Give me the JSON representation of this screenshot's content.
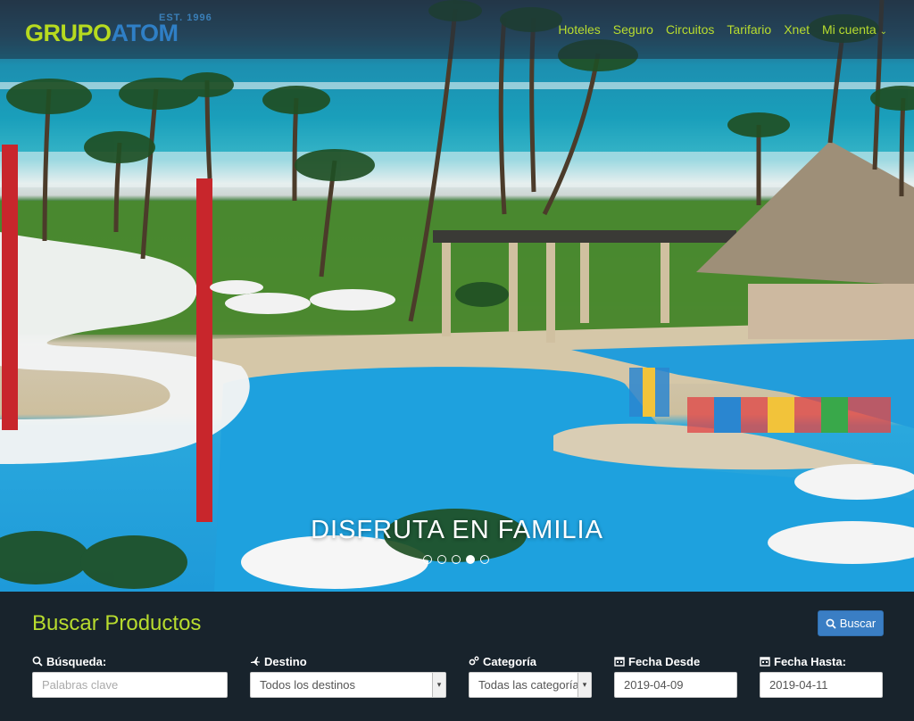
{
  "brand": {
    "name_part1": "GRUPO",
    "name_part2": "ATOM",
    "established": "EST. 1996"
  },
  "nav": {
    "items": [
      {
        "label": "Hoteles"
      },
      {
        "label": "Seguro"
      },
      {
        "label": "Circuitos"
      },
      {
        "label": "Tarifario"
      },
      {
        "label": "Xnet"
      },
      {
        "label": "Mi cuenta"
      }
    ]
  },
  "hero": {
    "caption": "DISFRUTA EN FAMILIA",
    "slides_total": 5,
    "active_slide": 4
  },
  "search": {
    "title": "Buscar Productos",
    "button_label": "Buscar",
    "fields": {
      "query": {
        "label": "Búsqueda:",
        "placeholder": "Palabras clave",
        "icon": "search-icon"
      },
      "destination": {
        "label": "Destino",
        "value": "Todos los destinos",
        "icon": "plane-icon"
      },
      "category": {
        "label": "Categoría",
        "value": "Todas las categorías",
        "icon": "gears-icon"
      },
      "date_from": {
        "label": "Fecha Desde",
        "value": "2019-04-09",
        "icon": "calendar-icon"
      },
      "date_to": {
        "label": "Fecha Hasta:",
        "value": "2019-04-11",
        "icon": "calendar-icon"
      }
    }
  },
  "colors": {
    "accent": "#b8dc2e",
    "brand_blue": "#2f7fc6",
    "panel_bg": "#18232c",
    "button": "#3a7ec4"
  }
}
